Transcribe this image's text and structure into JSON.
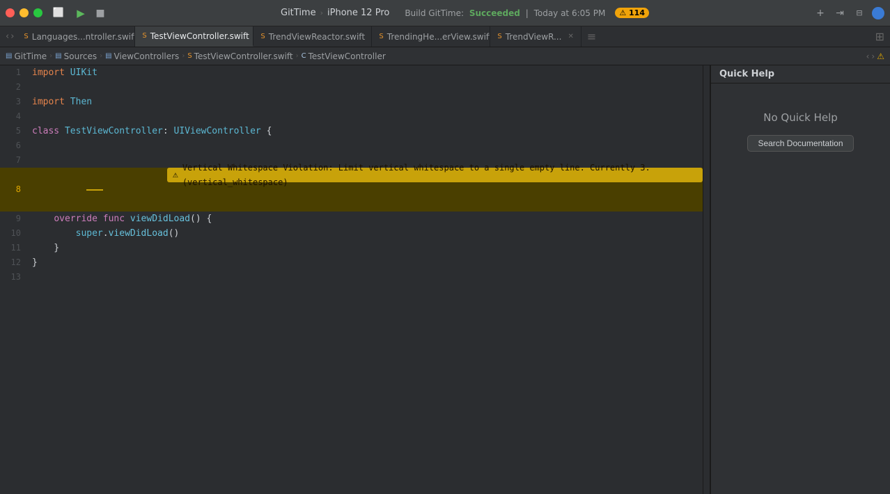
{
  "titlebar": {
    "project": "GitTime",
    "chevron": "›",
    "device": "iPhone 12 Pro",
    "build_prefix": "GitTime",
    "build_separator": "|",
    "build_label": "Build GitTime:",
    "build_status": "Succeeded",
    "build_time": "Today at 6:05 PM",
    "warning_count": "114",
    "plus_icon": "+",
    "arrow_icon": "⇥"
  },
  "tabs": [
    {
      "id": "tab1",
      "icon": "S",
      "label": "Languages...ntroller.swift",
      "active": false
    },
    {
      "id": "tab2",
      "icon": "S",
      "label": "TestViewController.swift",
      "active": true
    },
    {
      "id": "tab3",
      "icon": "S",
      "label": "TrendViewReactor.swift",
      "active": false
    },
    {
      "id": "tab4",
      "icon": "S",
      "label": "TrendingHe...erView.swift",
      "active": false
    },
    {
      "id": "tab5",
      "icon": "S",
      "label": "TrendViewR...",
      "active": false
    }
  ],
  "breadcrumb": {
    "items": [
      {
        "type": "folder",
        "label": "GitTime"
      },
      {
        "type": "folder",
        "label": "Sources"
      },
      {
        "type": "folder",
        "label": "ViewControllers"
      },
      {
        "type": "file",
        "label": "TestViewController.swift"
      },
      {
        "type": "class",
        "label": "TestViewController"
      }
    ]
  },
  "code": {
    "lines": [
      {
        "num": 1,
        "tokens": [
          {
            "t": "kw2",
            "v": "import"
          },
          {
            "t": "plain",
            "v": " "
          },
          {
            "t": "type",
            "v": "UIKit"
          }
        ],
        "warning": false
      },
      {
        "num": 2,
        "tokens": [],
        "warning": false
      },
      {
        "num": 3,
        "tokens": [
          {
            "t": "kw2",
            "v": "import"
          },
          {
            "t": "plain",
            "v": " "
          },
          {
            "t": "type",
            "v": "Then"
          }
        ],
        "warning": false
      },
      {
        "num": 4,
        "tokens": [],
        "warning": false
      },
      {
        "num": 5,
        "tokens": [
          {
            "t": "kw",
            "v": "class"
          },
          {
            "t": "plain",
            "v": " "
          },
          {
            "t": "type",
            "v": "TestViewController"
          },
          {
            "t": "plain",
            "v": ": "
          },
          {
            "t": "type",
            "v": "UIViewController"
          },
          {
            "t": "plain",
            "v": " {"
          }
        ],
        "warning": false
      },
      {
        "num": 6,
        "tokens": [],
        "warning": false
      },
      {
        "num": 7,
        "tokens": [],
        "warning": false
      },
      {
        "num": 8,
        "tokens": [],
        "warning": true,
        "warning_text": "Vertical Whitespace Violation: Limit vertical whitespace to a single empty line. Currently 3. (vertical_whitespace)"
      },
      {
        "num": 9,
        "tokens": [
          {
            "t": "plain",
            "v": "    "
          },
          {
            "t": "kw",
            "v": "override"
          },
          {
            "t": "plain",
            "v": " "
          },
          {
            "t": "kw",
            "v": "func"
          },
          {
            "t": "plain",
            "v": " "
          },
          {
            "t": "fn",
            "v": "viewDidLoad"
          },
          {
            "t": "plain",
            "v": "() {"
          }
        ],
        "warning": false
      },
      {
        "num": 10,
        "tokens": [
          {
            "t": "plain",
            "v": "        "
          },
          {
            "t": "type",
            "v": "super"
          },
          {
            "t": "plain",
            "v": "."
          },
          {
            "t": "fn",
            "v": "viewDidLoad"
          },
          {
            "t": "plain",
            "v": "()"
          }
        ],
        "warning": false
      },
      {
        "num": 11,
        "tokens": [
          {
            "t": "plain",
            "v": "    "
          },
          {
            "t": "plain",
            "v": "}"
          }
        ],
        "warning": false
      },
      {
        "num": 12,
        "tokens": [
          {
            "t": "plain",
            "v": "}"
          }
        ],
        "warning": false
      },
      {
        "num": 13,
        "tokens": [],
        "warning": false
      }
    ]
  },
  "quick_help": {
    "header": "Quick Help",
    "title": "No Quick Help",
    "search_btn": "Search Documentation"
  }
}
